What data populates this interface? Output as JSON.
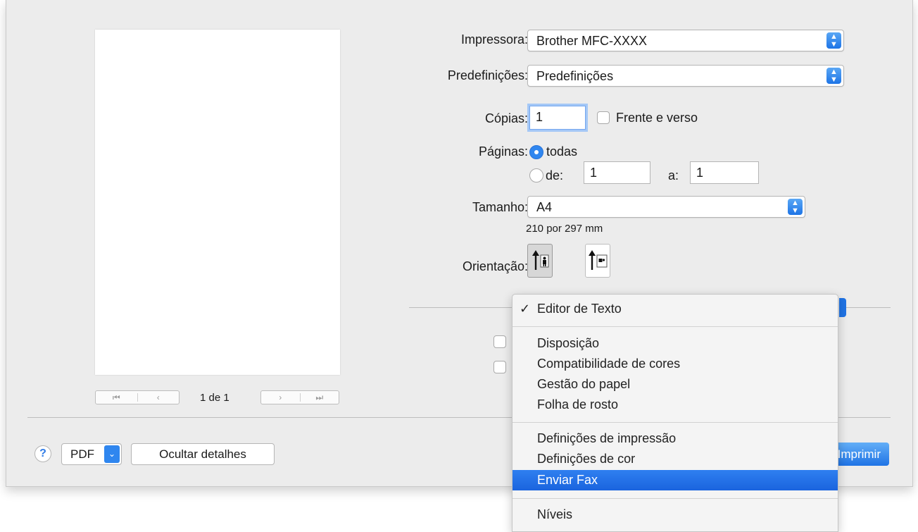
{
  "preview": {
    "page_counter": "1 de 1",
    "first_icon": "⏮",
    "prev_icon": "‹",
    "next_icon": "›",
    "last_icon": "⏭"
  },
  "printer": {
    "label": "Impressora:",
    "value": "Brother MFC-XXXX"
  },
  "presets": {
    "label": "Predefinições:",
    "value": "Predefinições"
  },
  "copies": {
    "label": "Cópias:",
    "value": "1",
    "duplex_label": "Frente e verso"
  },
  "pages": {
    "label": "Páginas:",
    "all_label": "todas",
    "from_label": "de:",
    "from_value": "1",
    "to_label": "a:",
    "to_value": "1"
  },
  "size": {
    "label": "Tamanho:",
    "value": "A4",
    "dimensions": "210 por 297 mm"
  },
  "orientation": {
    "label": "Orientação:",
    "selected": "portrait"
  },
  "footer": {
    "help_label": "?",
    "pdf_label": "PDF",
    "hide_details_label": "Ocultar detalhes",
    "print_label": "Imprimir"
  },
  "popup_menu": {
    "checked_mark": "✓",
    "items": [
      "Editor de Texto",
      "Disposição",
      "Compatibilidade de cores",
      "Gestão do papel",
      "Folha de rosto",
      "Definições de impressão",
      "Definições de cor",
      "Enviar Fax",
      "Níveis"
    ],
    "highlighted": "Enviar Fax"
  },
  "colors": {
    "accent": "#1f73e5",
    "dialog_bg": "#ececec"
  }
}
